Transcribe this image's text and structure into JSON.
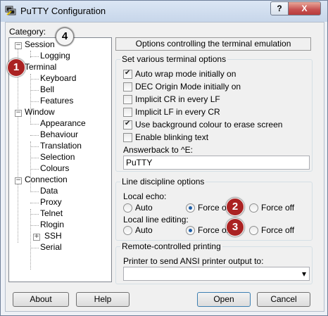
{
  "window": {
    "title": "PuTTY Configuration",
    "help_glyph": "?",
    "close_glyph": "X"
  },
  "category": {
    "label": "Category:",
    "items": {
      "session": "Session",
      "logging": "Logging",
      "terminal": "Terminal",
      "keyboard": "Keyboard",
      "bell": "Bell",
      "features": "Features",
      "window": "Window",
      "appearance": "Appearance",
      "behaviour": "Behaviour",
      "translation": "Translation",
      "selection": "Selection",
      "colours": "Colours",
      "connection": "Connection",
      "data": "Data",
      "proxy": "Proxy",
      "telnet": "Telnet",
      "rlogin": "Rlogin",
      "ssh": "SSH",
      "serial": "Serial"
    }
  },
  "panel": {
    "header": "Options controlling the terminal emulation",
    "terminal_options": {
      "title": "Set various terminal options",
      "auto_wrap": {
        "label": "Auto wrap mode initially on",
        "checked": true
      },
      "dec_origin": {
        "label": "DEC Origin Mode initially on",
        "checked": false
      },
      "implicit_cr": {
        "label": "Implicit CR in every LF",
        "checked": false
      },
      "implicit_lf": {
        "label": "Implicit LF in every CR",
        "checked": false
      },
      "bg_colour": {
        "label": "Use background colour to erase screen",
        "checked": true
      },
      "blinking": {
        "label": "Enable blinking text",
        "checked": false
      },
      "answerback_label": "Answerback to ^E:",
      "answerback_value": "PuTTY"
    },
    "line_discipline": {
      "title": "Line discipline options",
      "local_echo_label": "Local echo:",
      "local_editing_label": "Local line editing:",
      "auto": "Auto",
      "force_on": "Force on",
      "force_off": "Force off",
      "local_echo_selected": "Force on",
      "local_editing_selected": "Force on"
    },
    "printing": {
      "title": "Remote-controlled printing",
      "printer_label": "Printer to send ANSI printer output to:",
      "printer_value": "",
      "dropdown_glyph": "▾"
    }
  },
  "buttons": {
    "about": "About",
    "help": "Help",
    "open": "Open",
    "cancel": "Cancel"
  },
  "annotations": {
    "b1": "1",
    "b2": "2",
    "b3": "3",
    "b4": "4"
  },
  "colors": {
    "badge_red": "#a22222"
  }
}
